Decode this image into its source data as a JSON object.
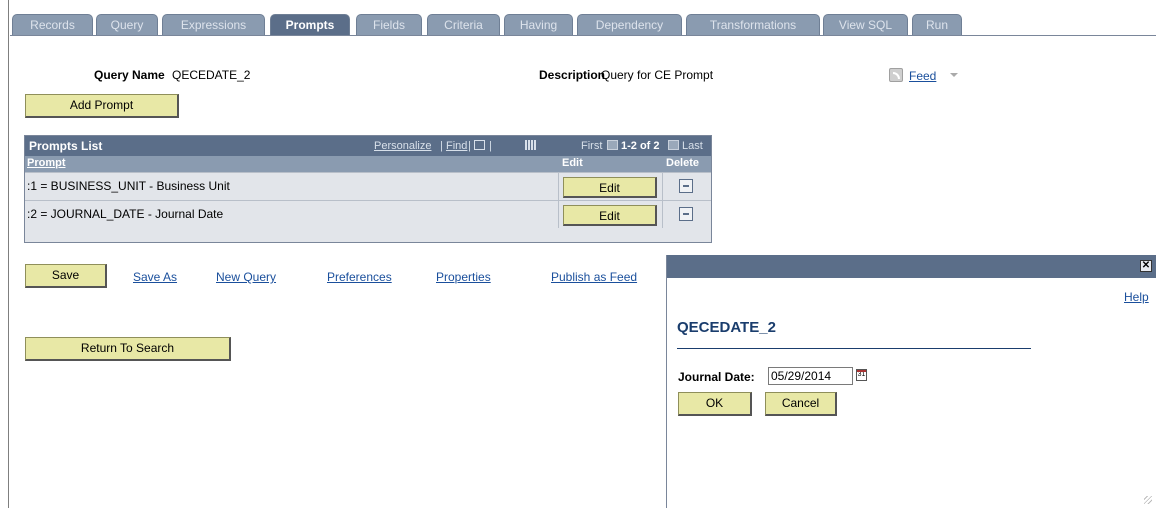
{
  "tabs": [
    {
      "label": "Records"
    },
    {
      "label": "Query"
    },
    {
      "label": "Expressions"
    },
    {
      "label": "Prompts",
      "active": true
    },
    {
      "label": "Fields"
    },
    {
      "label": "Criteria"
    },
    {
      "label": "Having"
    },
    {
      "label": "Dependency"
    },
    {
      "label": "Transformations"
    },
    {
      "label": "View SQL"
    },
    {
      "label": "Run"
    }
  ],
  "header": {
    "query_name_label": "Query Name",
    "query_name_value": "QECEDATE_2",
    "description_label": "Description",
    "description_value": "Query for CE Prompt",
    "feed_label": "Feed",
    "feed_icon": "rss-feed-icon"
  },
  "add_prompt_label": "Add Prompt",
  "prompts_grid": {
    "title": "Prompts List",
    "personalize": "Personalize",
    "find": "Find",
    "separator": "|",
    "first": "First",
    "range": "1-2 of 2",
    "last": "Last",
    "columns": {
      "prompt": "Prompt",
      "edit": "Edit",
      "delete": "Delete"
    },
    "rows": [
      {
        "prompt": ":1 = BUSINESS_UNIT - Business Unit",
        "edit": "Edit"
      },
      {
        "prompt": ":2 = JOURNAL_DATE - Journal Date",
        "edit": "Edit"
      }
    ]
  },
  "actions": {
    "save": "Save",
    "save_as": "Save As",
    "new_query": "New Query",
    "preferences": "Preferences",
    "properties": "Properties",
    "publish_as_feed": "Publish as Feed",
    "return_to_search": "Return To Search"
  },
  "dialog": {
    "close_glyph": "✕",
    "help": "Help",
    "title": "QECEDATE_2",
    "field_label": "Journal Date:",
    "field_value": "05/29/2014",
    "calendar_glyph": "31",
    "ok": "OK",
    "cancel": "Cancel"
  },
  "colors": {
    "tab_active": "#5b6e89",
    "tab_inactive": "#8a9bb0",
    "button_bg": "#e8e8a6",
    "link": "#1a4f9c"
  }
}
